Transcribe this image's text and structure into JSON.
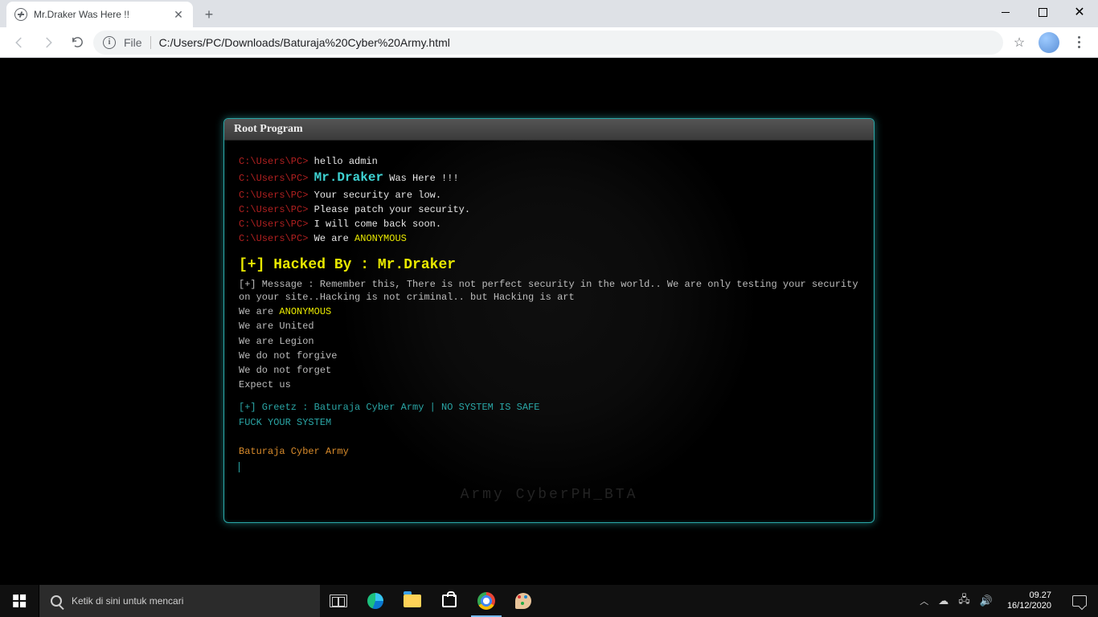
{
  "browser": {
    "tab_title": "Mr.Draker Was Here !!",
    "file_label": "File",
    "url": "C:/Users/PC/Downloads/Baturaja%20Cyber%20Army.html"
  },
  "console": {
    "title": "Root Program",
    "prompt": "C:\\Users\\PC>",
    "lines": {
      "l1": "hello admin",
      "name": "Mr.Draker",
      "l2_suffix": " Was Here !!!",
      "l3": "Your security are low.",
      "l4": "Please patch your security.",
      "l5": "I will come back soon.",
      "l6_prefix": "We are ",
      "anon": "ANONYMOUS"
    },
    "headline": "[+] Hacked By : Mr.Draker",
    "message": "[+] Message : Remember this, There is not perfect security in the world.. We are only testing your security on your site..Hacking is not criminal.. but Hacking is art",
    "manifesto": {
      "m1_prefix": "We are ",
      "m1_anon": "ANONYMOUS",
      "m2": "We are United",
      "m3": "We are Legion",
      "m4": "We do not forgive",
      "m5": "We do not forget",
      "m6": "Expect us"
    },
    "greetz": "[+] Greetz : Baturaja Cyber Army | NO SYSTEM IS SAFE",
    "fys": "FUCK YOUR SYSTEM",
    "signature": "Baturaja Cyber Army",
    "watermark": "Army CyberPH_BTA"
  },
  "taskbar": {
    "search_placeholder": "Ketik di sini untuk mencari",
    "time": "09.27",
    "date": "16/12/2020"
  }
}
